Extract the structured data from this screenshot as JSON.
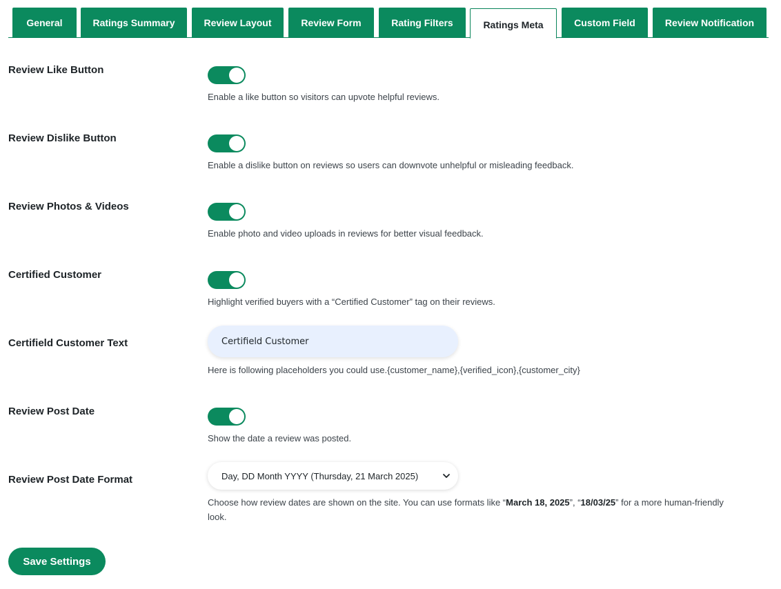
{
  "tabs": [
    {
      "label": "General"
    },
    {
      "label": "Ratings Summary"
    },
    {
      "label": "Review Layout"
    },
    {
      "label": "Review Form"
    },
    {
      "label": "Rating Filters"
    },
    {
      "label": "Ratings Meta"
    },
    {
      "label": "Custom Field"
    },
    {
      "label": "Review Notification"
    }
  ],
  "active_tab": "Ratings Meta",
  "settings": {
    "like": {
      "label": "Review Like Button",
      "enabled": true,
      "desc": "Enable a like button so visitors can upvote helpful reviews."
    },
    "dislike": {
      "label": "Review Dislike Button",
      "enabled": true,
      "desc": "Enable a dislike button on reviews so users can downvote unhelpful or misleading feedback."
    },
    "media": {
      "label": "Review Photos & Videos",
      "enabled": true,
      "desc": "Enable photo and video uploads in reviews for better visual feedback."
    },
    "certified": {
      "label": "Certified Customer",
      "enabled": true,
      "desc": "Highlight verified buyers with a “Certified Customer” tag on their reviews."
    },
    "certified_text": {
      "label": "Certifield Customer Text",
      "value": "Certifield Customer",
      "desc": "Here is following placeholders you could use.{customer_name},{verified_icon},{customer_city}"
    },
    "post_date": {
      "label": "Review Post Date",
      "enabled": true,
      "desc": "Show the date a review was posted."
    },
    "date_format": {
      "label": "Review Post Date Format",
      "selected": "Day, DD Month YYYY (Thursday, 21 March 2025)",
      "desc_pre": "Choose how review dates are shown on the site. You can use formats like “",
      "desc_ex1": "March 18, 2025",
      "desc_mid": "”, “",
      "desc_ex2": "18/03/25",
      "desc_post": "” for a more human-friendly look."
    }
  },
  "save_label": "Save Settings",
  "colors": {
    "accent": "#0b8a5e",
    "input_bg": "#e8f0fe",
    "text": "#1d2327"
  },
  "icons": {
    "select_arrow": "chevron-down-icon"
  }
}
